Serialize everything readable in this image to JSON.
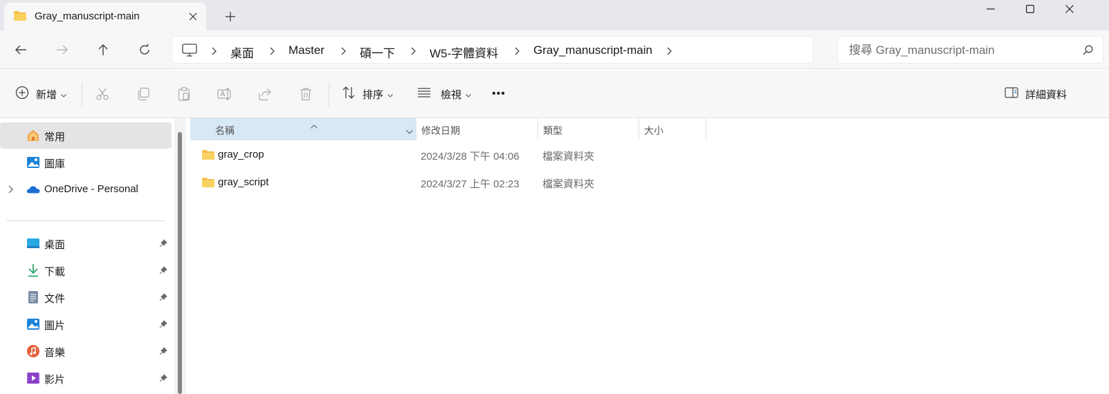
{
  "tab": {
    "title": "Gray_manuscript-main"
  },
  "breadcrumbs": [
    {
      "label": "桌面"
    },
    {
      "label": "Master"
    },
    {
      "label": "碩一下"
    },
    {
      "label": "W5-字體資料"
    },
    {
      "label": "Gray_manuscript-main"
    }
  ],
  "search": {
    "placeholder": "搜尋 Gray_manuscript-main"
  },
  "toolbar": {
    "new_label": "新增",
    "sort_label": "排序",
    "view_label": "檢視",
    "more_label": "•••",
    "details_label": "詳細資料"
  },
  "sidebar": {
    "top_items": [
      {
        "label": "常用",
        "icon": "home-icon",
        "selected": true
      },
      {
        "label": "圖庫",
        "icon": "gallery-icon"
      },
      {
        "label": "OneDrive - Personal",
        "icon": "onedrive-icon"
      }
    ],
    "pinned_items": [
      {
        "label": "桌面",
        "icon": "desktop-icon"
      },
      {
        "label": "下載",
        "icon": "download-icon"
      },
      {
        "label": "文件",
        "icon": "documents-icon"
      },
      {
        "label": "圖片",
        "icon": "pictures-icon"
      },
      {
        "label": "音樂",
        "icon": "music-icon"
      },
      {
        "label": "影片",
        "icon": "videos-icon"
      }
    ]
  },
  "columns": {
    "name": "名稱",
    "date": "修改日期",
    "type": "類型",
    "size": "大小"
  },
  "files": [
    {
      "name": "gray_crop",
      "date": "2024/3/28 下午 04:06",
      "type": "檔案資料夾"
    },
    {
      "name": "gray_script",
      "date": "2024/3/27 上午 02:23",
      "type": "檔案資料夾"
    }
  ],
  "colors": {
    "accent": "#0067c0",
    "folder": "#f3c04c",
    "selected_header": "#d7e8f6",
    "chrome": "#e7e8ee"
  }
}
